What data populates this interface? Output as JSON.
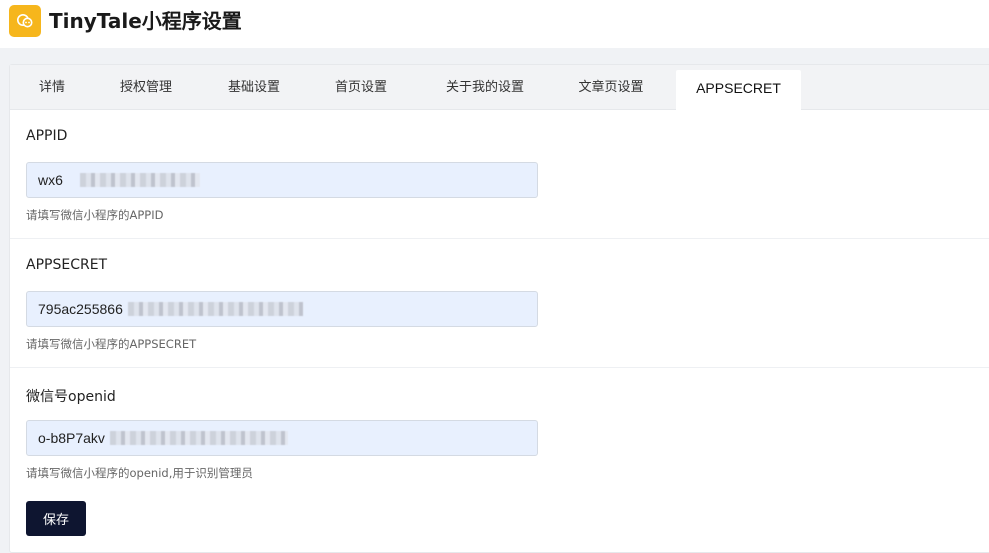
{
  "app": {
    "title": "TinyTale小程序设置",
    "logo_icon": "chat-bubble-icon",
    "logo_color": "#f6b61c"
  },
  "tabs": [
    {
      "label": "详情",
      "active": false
    },
    {
      "label": "授权管理",
      "active": false
    },
    {
      "label": "基础设置",
      "active": false
    },
    {
      "label": "首页设置",
      "active": false
    },
    {
      "label": "关于我的设置",
      "active": false
    },
    {
      "label": "文章页设置",
      "active": false
    },
    {
      "label": "APPSECRET",
      "active": true
    }
  ],
  "form": {
    "appid": {
      "label": "APPID",
      "value": "wx6",
      "help": "请填写微信小程序的APPID"
    },
    "appsecret": {
      "label": "APPSECRET",
      "value": "795ac255866",
      "help": "请填写微信小程序的APPSECRET"
    },
    "openid": {
      "label": "微信号openid",
      "value": "o-b8P7akv",
      "help": "请填写微信小程序的openid,用于识别管理员"
    },
    "save_label": "保存"
  },
  "colors": {
    "accent": "#0e1530",
    "input_bg": "#e8f0fe"
  }
}
